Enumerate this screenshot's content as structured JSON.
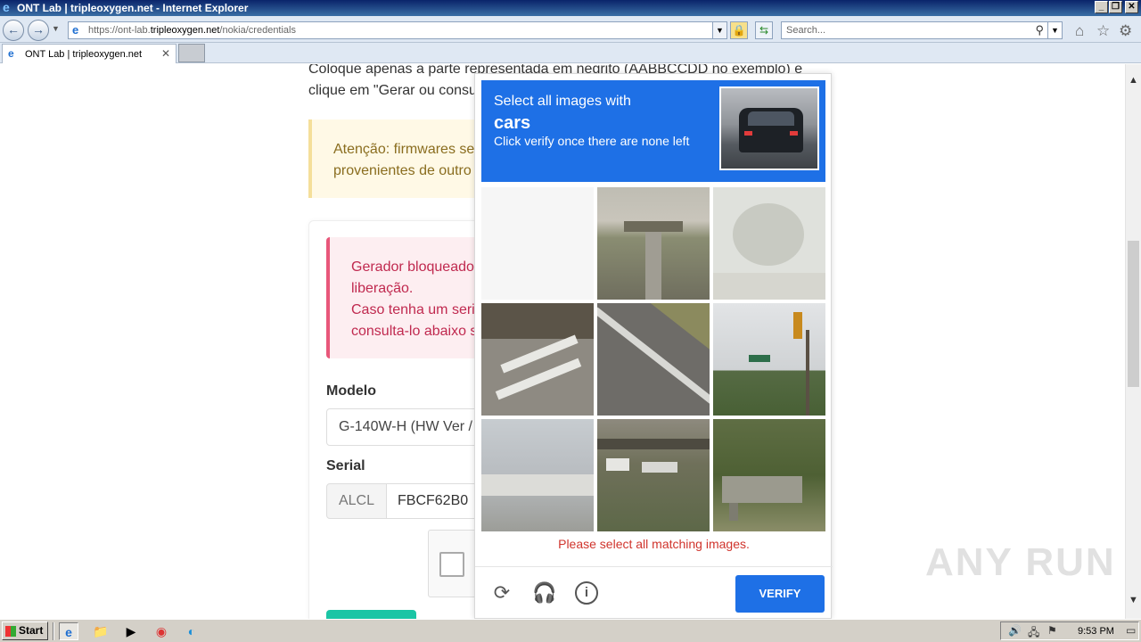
{
  "window": {
    "title": "ONT Lab | tripleoxygen.net - Internet Explorer"
  },
  "address_bar": {
    "url_prefix": "https://ont-lab.",
    "url_domain": "tripleoxygen.net",
    "url_path": "/nokia/credentials",
    "search_placeholder": "Search..."
  },
  "tabs": [
    {
      "label": "ONT Lab | tripleoxygen.net"
    }
  ],
  "page": {
    "intro_line1": "Coloque apenas a parte representada em negrito (AABBCCDD no exemplo) e",
    "intro_line2": "clique em \"Gerar ou consu",
    "warning_line1": "Atenção: firmwares ser",
    "warning_line2": "provenientes de outro",
    "danger_line1": "Gerador bloqueado",
    "danger_line2": "liberação.",
    "danger_line3": "Caso tenha um seria",
    "danger_line4": "consulta-lo abaixo s",
    "model_label": "Modelo",
    "model_value": "G-140W-H (HW Ver /",
    "serial_label": "Serial",
    "serial_prefix": "ALCL",
    "serial_value": "FBCF62B0"
  },
  "captcha": {
    "prompt_line1": "Select all images with",
    "prompt_target": "cars",
    "prompt_line3": "Click verify once there are none left",
    "error": "Please select all matching images.",
    "verify_label": "VERIFY",
    "icons": [
      "refresh-icon",
      "headphones-icon",
      "info-icon"
    ]
  },
  "watermark": "ANY RUN",
  "taskbar": {
    "start_label": "Start",
    "clock": "9:53 PM"
  },
  "colors": {
    "captcha_blue": "#1e70e6",
    "error_red": "#d0342c",
    "danger_text": "#c0294f",
    "warning_text": "#8a6d1f"
  }
}
